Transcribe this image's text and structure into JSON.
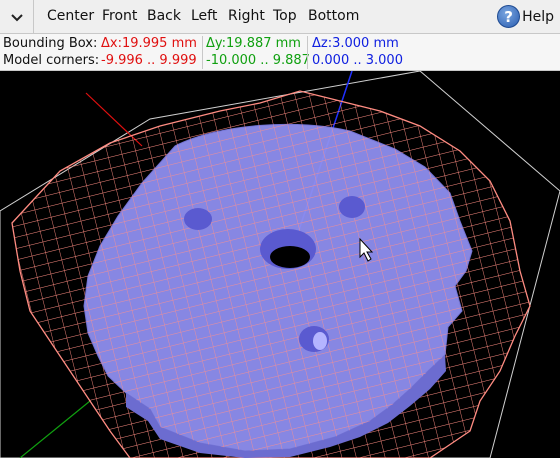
{
  "toolbar": {
    "view_buttons": [
      "Center",
      "Front",
      "Back",
      "Left",
      "Right",
      "Top",
      "Bottom"
    ],
    "help_label": "Help",
    "help_glyph": "?",
    "menu_icon": "chevron-down-icon"
  },
  "info": {
    "bbox_label": "Bounding Box:",
    "corners_label": "Model corners:",
    "dx": "Δx:19.995 mm",
    "dy": "Δy:19.887 mm",
    "dz": "Δz:3.000 mm",
    "x_range": "-9.996 .. 9.999",
    "y_range": "-10.000 .. 9.887",
    "z_range": "0.000 .. 3.000",
    "colors": {
      "x": "#e01010",
      "y": "#10a010",
      "z": "#1020e0"
    }
  },
  "viewport": {
    "background": "#000000",
    "model_color": "#8f8ff0",
    "mesh_color": "#ff8c82",
    "axis_colors": {
      "x": "#e01010",
      "y": "#10a010",
      "z": "#2030ff"
    }
  }
}
